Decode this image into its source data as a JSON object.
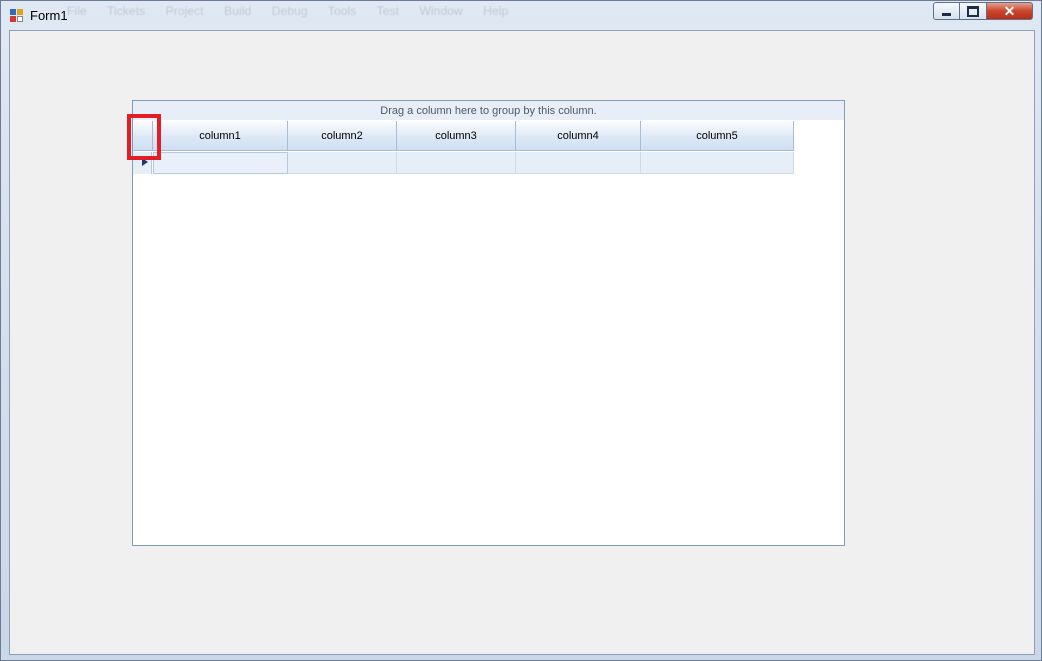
{
  "window": {
    "title": "Form1",
    "faded_menu": [
      "File",
      "Tickets",
      "Project",
      "Build",
      "Debug",
      "Tools",
      "Test",
      "Window",
      "Help"
    ]
  },
  "grid": {
    "group_panel_text": "Drag a column here to group by this column.",
    "columns": [
      "column1",
      "column2",
      "column3",
      "column4",
      "column5"
    ]
  },
  "colors": {
    "highlight": "#e01e26",
    "header_blue": "#dde8f6",
    "row_blue": "#e6eef8",
    "form_background": "#f0f0f0"
  }
}
